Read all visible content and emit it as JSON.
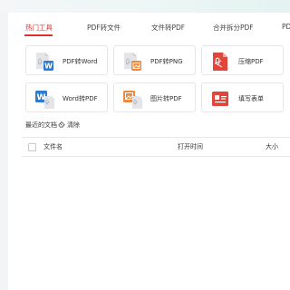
{
  "tabs": [
    {
      "label": "热门工具",
      "active": true
    },
    {
      "label": "PDF转文件"
    },
    {
      "label": "文件转PDF"
    },
    {
      "label": "合并拆分PDF"
    },
    {
      "label": "PD"
    }
  ],
  "tools": [
    {
      "label": "PDF转Word",
      "icon": "pdf-to-word-icon"
    },
    {
      "label": "PDF转PNG",
      "icon": "pdf-to-png-icon"
    },
    {
      "label": "压缩PDF",
      "icon": "compress-pdf-icon"
    },
    {
      "label": "Word转PDF",
      "icon": "word-to-pdf-icon"
    },
    {
      "label": "图片转PDF",
      "icon": "image-to-pdf-icon"
    },
    {
      "label": "填写表单",
      "icon": "fill-form-icon"
    }
  ],
  "recent": {
    "title": "最近的文档",
    "clear_label": "清除"
  },
  "table": {
    "columns": [
      "文件名",
      "打开时间",
      "大小"
    ]
  },
  "colors": {
    "accent": "#d9342b",
    "word_blue": "#2b7cd3",
    "png_orange": "#ef8a3c",
    "pdf_red": "#e2453c"
  }
}
